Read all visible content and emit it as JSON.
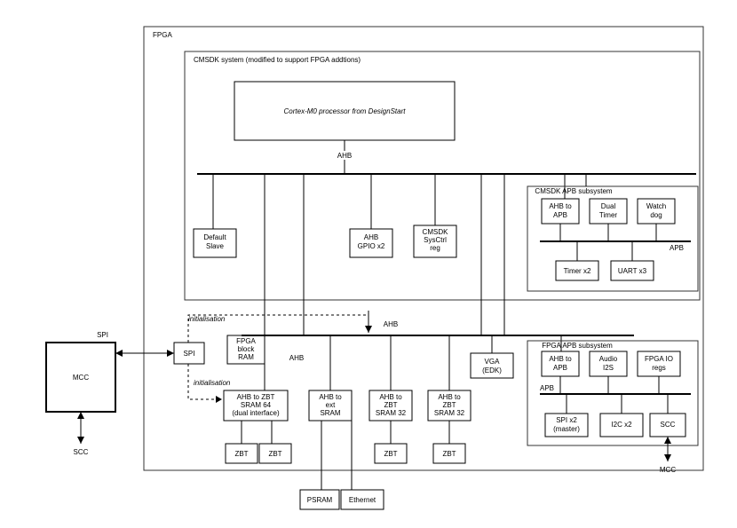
{
  "fpga": "FPGA",
  "cmsdk_sys": "CMSDK system (modified to support FPGA addtions)",
  "cortex": "Cortex-M0 processor from DesignStart",
  "ahb": "AHB",
  "default_slave": {
    "l1": "Default",
    "l2": "Slave"
  },
  "ahb_gpio": {
    "l1": "AHB",
    "l2": "GPIO x2"
  },
  "sysctrl": {
    "l1": "CMSDK",
    "l2": "SysCtrl",
    "l3": "reg"
  },
  "cmsdk_apb": "CMSDK APB subsystem",
  "ahb_to_apb": {
    "l1": "AHB to",
    "l2": "APB"
  },
  "dual_timer": {
    "l1": "Dual",
    "l2": "Timer"
  },
  "watchdog": {
    "l1": "Watch",
    "l2": "dog"
  },
  "apb": "APB",
  "timer_x2": "Timer x2",
  "uart_x3": "UART x3",
  "mcc": "MCC",
  "spi_label": "SPI",
  "scc_label": "SCC",
  "initialisation": "initialisation",
  "spi_box": "SPI",
  "fpga_ram": {
    "l1": "FPGA",
    "l2": "block",
    "l3": "RAM"
  },
  "ahb_zbt64": {
    "l1": "AHB to ZBT",
    "l2": "SRAM 64",
    "l3": "(dual interface)"
  },
  "ahb_ext": {
    "l1": "AHB to",
    "l2": "ext",
    "l3": "SRAM"
  },
  "ahb_zbt32a": {
    "l1": "AHB to",
    "l2": "ZBT",
    "l3": "SRAM 32"
  },
  "ahb_zbt32b": {
    "l1": "AHB to",
    "l2": "ZBT",
    "l3": "SRAM 32"
  },
  "vga": {
    "l1": "VGA",
    "l2": "(EDK)"
  },
  "fpga_apb": "FPGA APB subsystem",
  "audio_i2s": {
    "l1": "Audio",
    "l2": "I2S"
  },
  "fpga_io": {
    "l1": "FPGA IO",
    "l2": "regs"
  },
  "spi_x2": {
    "l1": "SPI x2",
    "l2": "(master)"
  },
  "i2c_x2": "I2C x2",
  "scc_box": "SCC",
  "zbt": "ZBT",
  "psram": "PSRAM",
  "ethernet": "Ethernet",
  "mcc2": "MCC",
  "ahb2": "AHB"
}
